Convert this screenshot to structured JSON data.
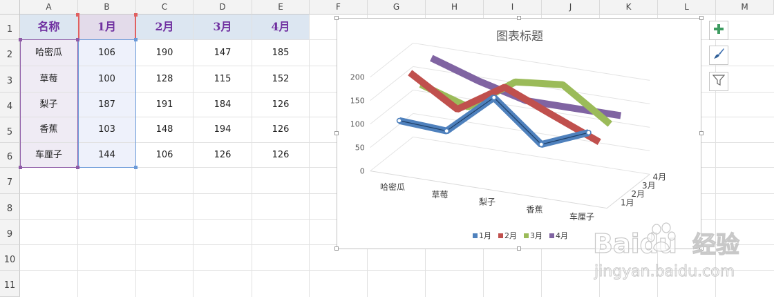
{
  "columns": [
    "A",
    "B",
    "C",
    "D",
    "E",
    "F",
    "G",
    "H",
    "I",
    "J",
    "K",
    "L",
    "M"
  ],
  "rows": [
    "1",
    "2",
    "3",
    "4",
    "5",
    "6",
    "7",
    "8",
    "9",
    "10",
    "11"
  ],
  "table": {
    "header": [
      "名称",
      "1月",
      "2月",
      "3月",
      "4月"
    ],
    "rows": [
      [
        "哈密瓜",
        "106",
        "190",
        "147",
        "185"
      ],
      [
        "草莓",
        "100",
        "128",
        "115",
        "152"
      ],
      [
        "梨子",
        "187",
        "191",
        "184",
        "126"
      ],
      [
        "香蕉",
        "103",
        "148",
        "194",
        "126"
      ],
      [
        "车厘子",
        "144",
        "106",
        "126",
        "126"
      ]
    ]
  },
  "colors": {
    "header_fill": "#dce6f1",
    "name_fill": "#efebf4",
    "jan_fill": "#eef1fb",
    "jan_header_fill": "#e3dbea",
    "header_text": "#7030a0",
    "series_1": "#4f81bd",
    "series_2": "#c0504d",
    "series_3": "#9bbb59",
    "series_4": "#8064a2"
  },
  "chart_data": {
    "type": "line",
    "style": "3d-line",
    "title": "图表标题",
    "categories": [
      "哈密瓜",
      "草莓",
      "梨子",
      "香蕉",
      "车厘子"
    ],
    "series": [
      {
        "name": "1月",
        "values": [
          106,
          100,
          187,
          103,
          144
        ]
      },
      {
        "name": "2月",
        "values": [
          190,
          128,
          191,
          148,
          106
        ]
      },
      {
        "name": "3月",
        "values": [
          147,
          115,
          184,
          194,
          126
        ]
      },
      {
        "name": "4月",
        "values": [
          185,
          152,
          126,
          126,
          126
        ]
      }
    ],
    "y_ticks": [
      "0",
      "50",
      "100",
      "150",
      "200"
    ],
    "ylim": [
      0,
      200
    ],
    "depth_labels": [
      "1月",
      "2月",
      "3月",
      "4月"
    ],
    "legend": "bottom",
    "grid": true,
    "selected_series": "1月"
  },
  "side_buttons": [
    {
      "icon": "plus-icon"
    },
    {
      "icon": "brush-icon"
    },
    {
      "icon": "filter-icon"
    }
  ],
  "watermark": {
    "brand": "Baidu",
    "jingyan": "经验",
    "url": "jingyan.baidu.com"
  }
}
